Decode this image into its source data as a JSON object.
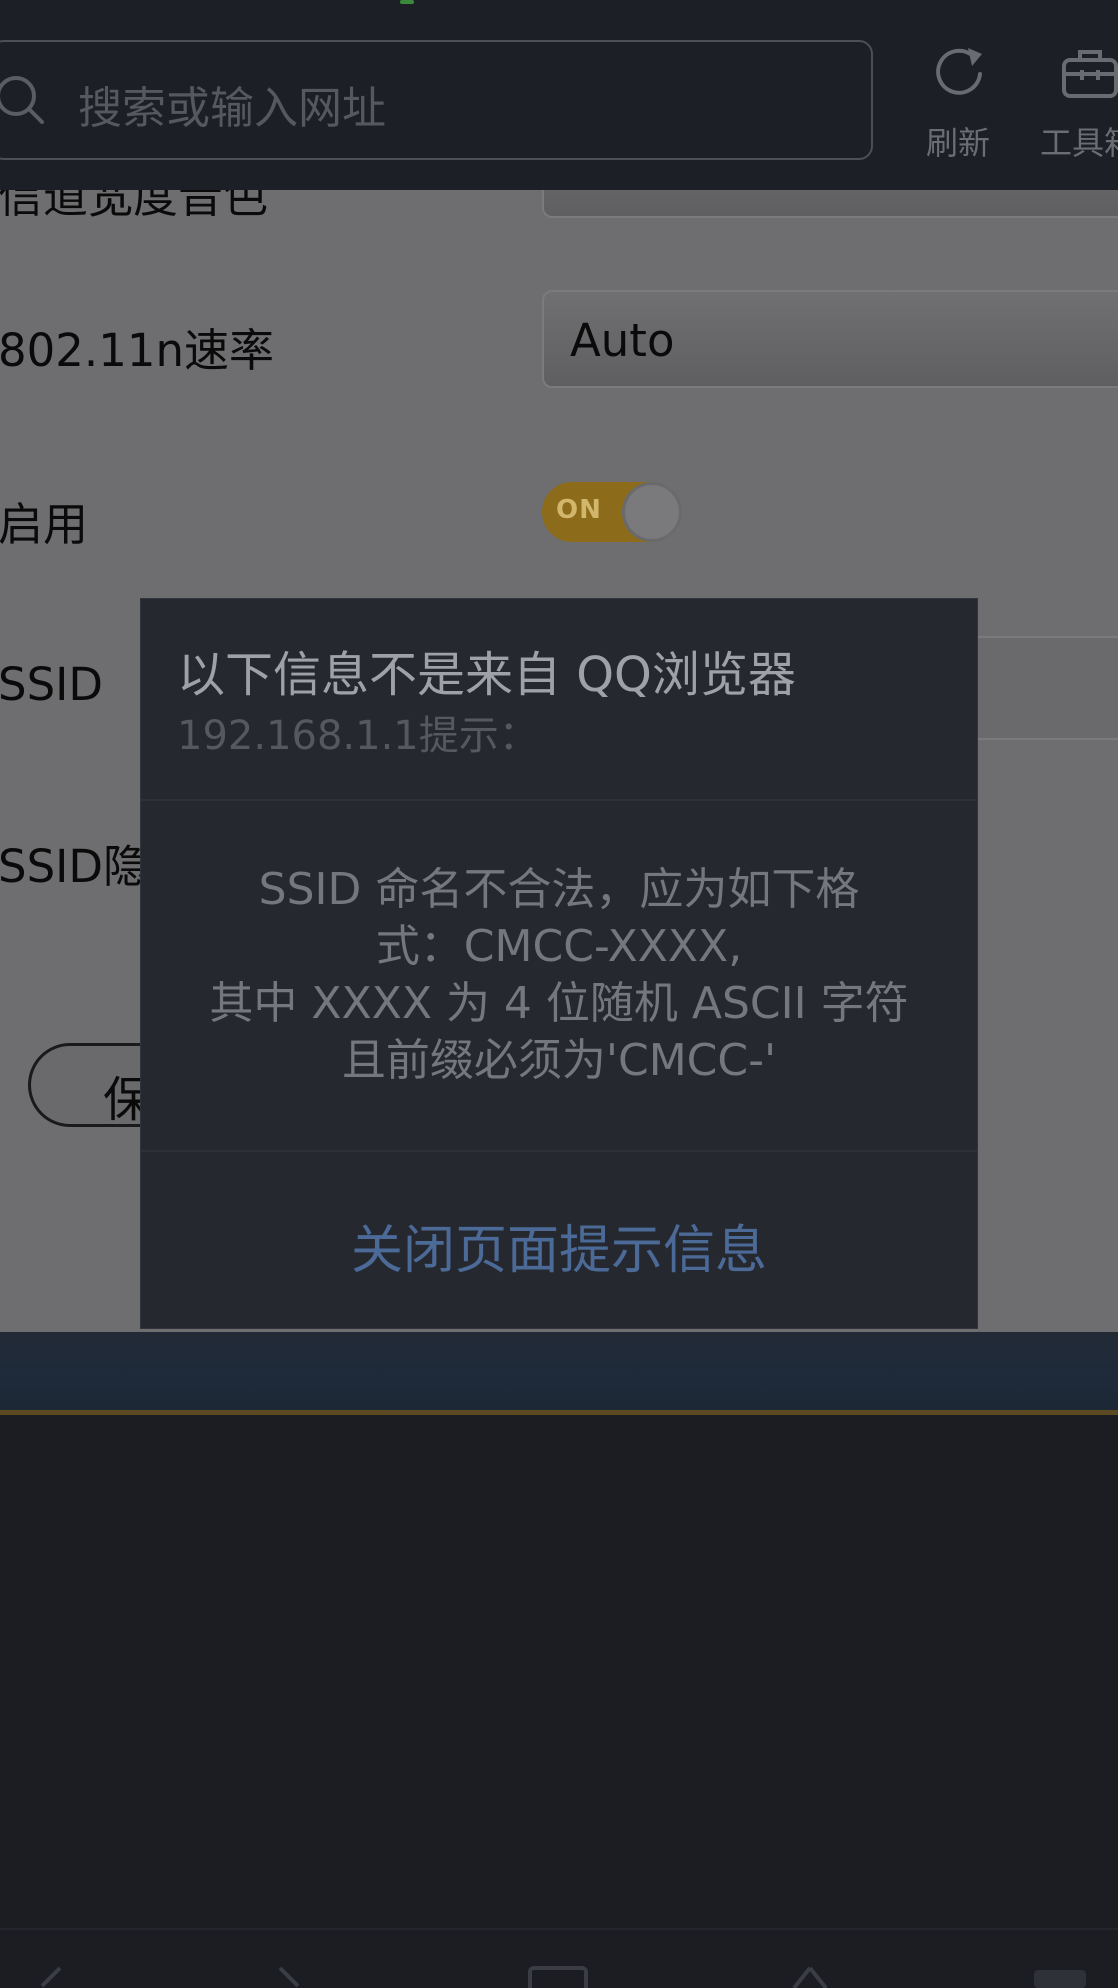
{
  "browser": {
    "search_placeholder": "搜索或输入网址",
    "refresh_label": "刷新",
    "toolbox_label": "工具箱"
  },
  "page": {
    "field_prev_label": "信道宽度音色",
    "field_rate_label": "802.11n速率",
    "rate_value": "Auto",
    "enable_label": "启用",
    "toggle_text": "ON",
    "ssid_label": "SSID",
    "ssid_hide_label": "SSID隐",
    "save_label": "保"
  },
  "dialog": {
    "title": "以下信息不是来自 QQ浏览器",
    "subtitle": "192.168.1.1提示：",
    "message_lines": [
      "SSID 命名不合法，应为如下格",
      "式：CMCC-XXXX,",
      "其中 XXXX 为 4 位随机 ASCII 字符",
      "且前缀必须为'CMCC-'"
    ],
    "close_label": "关闭页面提示信息"
  },
  "colors": {
    "accent_link": "#4c6a98",
    "toggle_on": "#8c6c1a",
    "browser_bar": "#1c1f25"
  }
}
